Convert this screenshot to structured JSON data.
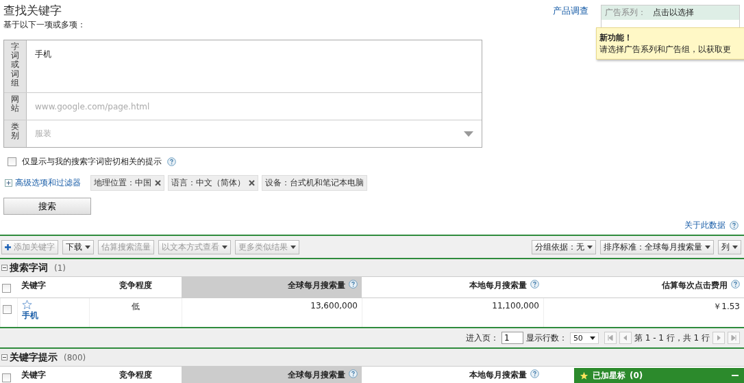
{
  "header": {
    "title": "查找关键字",
    "subtitle": "基于以下一项或多项：",
    "link": "产品调查"
  },
  "ad_selector": {
    "campaign_label": "广告系列：",
    "campaign_value": "点击以选择"
  },
  "tooltip": {
    "title": "新功能！",
    "text": "请选择广告系列和广告组，以获取更"
  },
  "inputs": [
    {
      "kind": "textarea",
      "label": "字词或词组",
      "value": "手机"
    },
    {
      "kind": "text",
      "label": "网站",
      "placeholder": "www.google.com/page.html"
    },
    {
      "kind": "dropdown",
      "label": "类别",
      "placeholder": "服装"
    }
  ],
  "closely_related": {
    "label": "仅显示与我的搜索字词密切相关的提示",
    "checked": false
  },
  "advanced_link": "高级选项和过滤器",
  "filters": [
    {
      "label": "地理位置：中国",
      "removable": true
    },
    {
      "label": "语言：中文（简体）",
      "removable": true
    },
    {
      "label": "设备：台式机和笔记本电脑",
      "removable": false
    }
  ],
  "search_button": "搜索",
  "about_link": "关于此数据",
  "toolbar": {
    "left": [
      {
        "kind": "add",
        "label": "添加关键字",
        "disabled": true
      },
      {
        "kind": "menu",
        "label": "下载",
        "disabled": false
      },
      {
        "kind": "plain",
        "label": "估算搜索流量",
        "disabled": true
      },
      {
        "kind": "menu",
        "label": "以文本方式查看",
        "disabled": true
      },
      {
        "kind": "menu",
        "label": "更多类似结果",
        "disabled": true
      }
    ],
    "right": [
      {
        "kind": "menu",
        "label": "分组依据：无",
        "disabled": false
      },
      {
        "kind": "menu",
        "label": "排序标准：全球每月搜索量",
        "disabled": false
      },
      {
        "kind": "menu",
        "label": "列",
        "disabled": false
      }
    ]
  },
  "search_terms": {
    "title": "搜索字词",
    "count": "(1)",
    "expanded": true,
    "all_checked": false,
    "columns": [
      {
        "label": "关键字",
        "help": false,
        "sorted": false
      },
      {
        "label": "竞争程度",
        "help": false,
        "sorted": false
      },
      {
        "label": "全球每月搜索量",
        "help": true,
        "sorted": true
      },
      {
        "label": "本地每月搜索量",
        "help": true,
        "sorted": false
      },
      {
        "label": "估算每次点击费用",
        "help": true,
        "sorted": false
      }
    ],
    "rows": [
      {
        "checked": false,
        "starred": false,
        "keyword": "手机",
        "competition": "低",
        "global": "13,600,000",
        "local": "11,100,000",
        "cpc": "￥1.53"
      }
    ]
  },
  "pagination": {
    "page_label": "进入页：",
    "page": "1",
    "rows_label": "显示行数：",
    "rows": "50",
    "range": "第 1 - 1 行，共 1 行"
  },
  "keyword_ideas": {
    "title": "关键字提示",
    "count": "(800)",
    "expanded": true,
    "all_checked": false,
    "columns": [
      {
        "label": "关键字",
        "help": false,
        "sorted": false
      },
      {
        "label": "竞争程度",
        "help": false,
        "sorted": false
      },
      {
        "label": "全球每月搜索量",
        "help": true,
        "sorted": true
      },
      {
        "label": "本地每月搜索量",
        "help": true,
        "sorted": false
      }
    ]
  },
  "starred_panel": {
    "label": "已加星标",
    "count": "(0)"
  }
}
